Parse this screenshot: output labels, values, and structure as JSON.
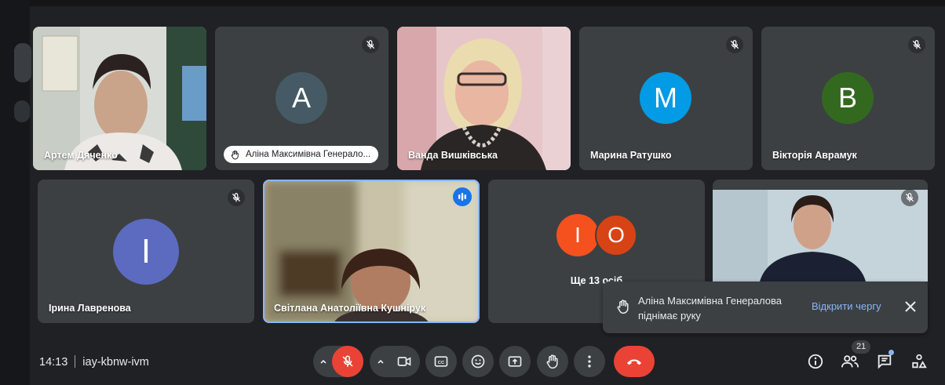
{
  "row1": [
    {
      "name": "Артем Дяченко",
      "video": true,
      "muted": false
    },
    {
      "name": "",
      "avatar_letter": "A",
      "avatar_color": "#455a64",
      "muted": true,
      "hand_raised_by": "Аліна Максимівна Генерало..."
    },
    {
      "name": "Ванда Вишківська",
      "video": true,
      "muted": false
    },
    {
      "name": "Марина Ратушко",
      "avatar_letter": "M",
      "avatar_color": "#039be5",
      "muted": true
    },
    {
      "name": "Вікторія Аврамук",
      "avatar_letter": "B",
      "avatar_color": "#33691e",
      "muted": true
    }
  ],
  "row2": [
    {
      "name": "Ірина Лавренова",
      "avatar_letter": "I",
      "avatar_color": "#5c6bc0",
      "muted": true
    },
    {
      "name": "Світлана Анатоліївна Кушнірук",
      "video": true,
      "speaking": true
    },
    {
      "more_avatars": [
        {
          "letter": "I",
          "color": "#f4511e"
        },
        {
          "letter": "O",
          "color": "#d84315"
        }
      ],
      "more_label": "Ще 13 осіб"
    },
    {
      "name": "",
      "video": true,
      "muted": true
    }
  ],
  "toast": {
    "line1": "Аліна Максимівна Генералова",
    "line2": "піднімає руку",
    "action": "Відкрити чергу",
    "close_icon": "close-icon"
  },
  "bottom": {
    "time": "14:13",
    "meeting_code": "iay-kbnw-ivm",
    "participants_count": "21",
    "colors": {
      "end_call": "#ea4335",
      "mic_off": "#ea4335",
      "bar": "#202124"
    }
  }
}
